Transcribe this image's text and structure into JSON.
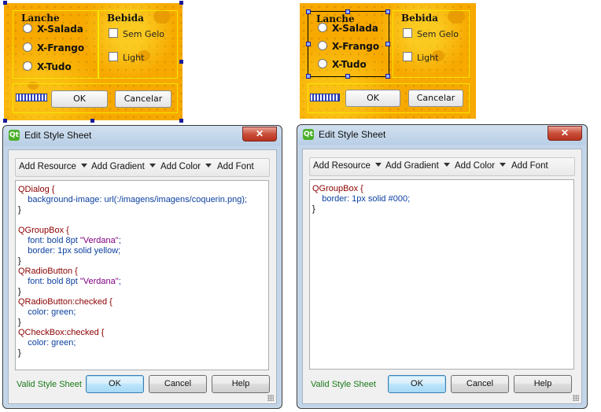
{
  "left_form": {
    "lanche_title": "Lanche",
    "bebida_title": "Bebida",
    "radios": [
      "X-Salada",
      "X-Frango",
      "X-Tudo"
    ],
    "checks": [
      "Sem Gelo",
      "Light"
    ],
    "ok_label": "OK",
    "cancel_label": "Cancelar"
  },
  "right_form": {
    "lanche_title": "Lanche",
    "bebida_title": "Bebida",
    "radios": [
      "X-Salada",
      "X-Frango",
      "X-Tudo"
    ],
    "checks": [
      "Sem Gelo",
      "Light"
    ],
    "ok_label": "OK",
    "cancel_label": "Cancelar"
  },
  "dialog_left": {
    "title": "Edit Style Sheet",
    "toolbar": [
      "Add Resource",
      "Add Gradient",
      "Add Color",
      "Add Font"
    ],
    "code": [
      "QDialog {",
      "    background-image: url(:/imagens/imagens/coquerin.png);",
      "}",
      "",
      "QGroupBox {",
      "    font: bold 8pt \"Verdana\";",
      "    border: 1px solid yellow;",
      "}",
      "QRadioButton {",
      "    font: bold 8pt \"Verdana\";",
      "}",
      "QRadioButton:checked {",
      "    color: green;",
      "}",
      "QCheckBox:checked {",
      "    color: green;",
      "}"
    ],
    "status": "Valid Style Sheet",
    "buttons": {
      "ok": "OK",
      "cancel": "Cancel",
      "help": "Help"
    }
  },
  "dialog_right": {
    "title": "Edit Style Sheet",
    "toolbar": [
      "Add Resource",
      "Add Gradient",
      "Add Color",
      "Add Font"
    ],
    "code": [
      "QGroupBox {",
      "    border: 1px solid #000;",
      "}"
    ],
    "status": "Valid Style Sheet",
    "buttons": {
      "ok": "OK",
      "cancel": "Cancel",
      "help": "Help"
    }
  },
  "icons": {
    "qt_logo": "qt-logo-icon",
    "close": "close-icon",
    "dropdown": "chevron-down-icon",
    "handle": "selection-handle-icon"
  },
  "colors": {
    "form_bg": "#f7a900",
    "group_border_yellow": "#f5e600",
    "group_border_black": "#000000",
    "valid_text": "#1a7a1a",
    "close_button": "#c94e3a"
  }
}
